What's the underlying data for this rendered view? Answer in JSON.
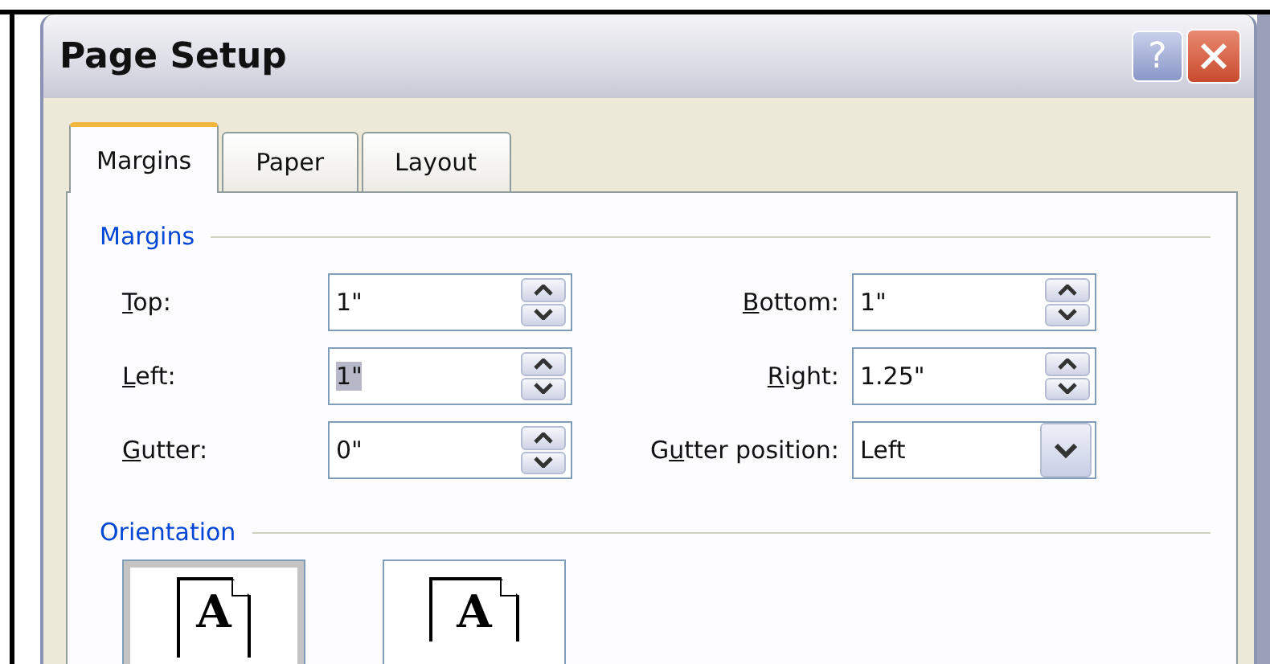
{
  "window": {
    "title": "Page Setup",
    "help_glyph": "?"
  },
  "tabs": [
    {
      "label": "Margins",
      "selected": true
    },
    {
      "label": "Paper",
      "selected": false
    },
    {
      "label": "Layout",
      "selected": false
    }
  ],
  "margins": {
    "heading": "Margins",
    "fields": [
      {
        "kind": "spin",
        "label": {
          "key": "T",
          "after": "op:"
        },
        "value": "1\"",
        "highlighted": false
      },
      {
        "kind": "spin",
        "label": {
          "key": "B",
          "after": "ottom:"
        },
        "value": "1\"",
        "highlighted": false
      },
      {
        "kind": "spin",
        "label": {
          "key": "L",
          "after": "eft:"
        },
        "value": "1\"",
        "highlighted": true
      },
      {
        "kind": "spin",
        "label": {
          "key": "R",
          "after": "ight:"
        },
        "value": "1.25\"",
        "highlighted": false
      },
      {
        "kind": "spin",
        "label": {
          "key": "G",
          "after": "utter:"
        },
        "value": "0\"",
        "highlighted": false
      },
      {
        "kind": "combo",
        "label": {
          "before": "G",
          "key": "u",
          "after": "tter position:"
        },
        "value": "Left",
        "highlighted": false
      }
    ]
  },
  "orientation": {
    "heading": "Orientation",
    "options": [
      {
        "glyph": "A",
        "kind": "portrait",
        "selected": true
      },
      {
        "glyph": "A",
        "kind": "landscape",
        "selected": false
      }
    ]
  }
}
